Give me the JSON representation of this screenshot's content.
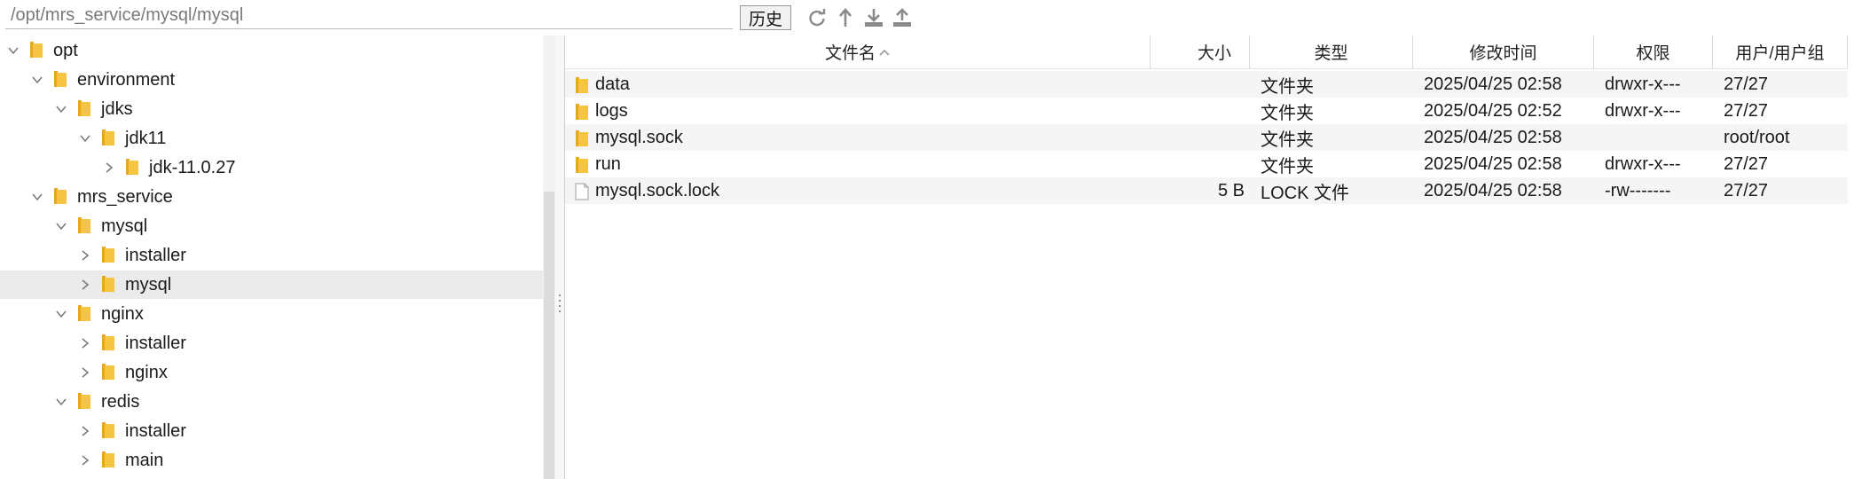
{
  "toolbar": {
    "path_value": "/opt/mrs_service/mysql/mysql",
    "history_label": "历史",
    "icons": [
      "refresh-icon",
      "go-up-icon",
      "download-icon",
      "upload-icon"
    ]
  },
  "tree": {
    "items": [
      {
        "label": "opt",
        "depth": 0,
        "expanded": true
      },
      {
        "label": "environment",
        "depth": 1,
        "expanded": true
      },
      {
        "label": "jdks",
        "depth": 2,
        "expanded": true
      },
      {
        "label": "jdk11",
        "depth": 3,
        "expanded": true
      },
      {
        "label": "jdk-11.0.27",
        "depth": 4,
        "expanded": false
      },
      {
        "label": "mrs_service",
        "depth": 1,
        "expanded": true
      },
      {
        "label": "mysql",
        "depth": 2,
        "expanded": true
      },
      {
        "label": "installer",
        "depth": 3,
        "expanded": false
      },
      {
        "label": "mysql",
        "depth": 3,
        "expanded": false,
        "selected": true
      },
      {
        "label": "nginx",
        "depth": 2,
        "expanded": true
      },
      {
        "label": "installer",
        "depth": 3,
        "expanded": false
      },
      {
        "label": "nginx",
        "depth": 3,
        "expanded": false
      },
      {
        "label": "redis",
        "depth": 2,
        "expanded": true
      },
      {
        "label": "installer",
        "depth": 3,
        "expanded": false
      },
      {
        "label": "main",
        "depth": 3,
        "expanded": false
      }
    ]
  },
  "files": {
    "columns": {
      "name": "文件名",
      "size": "大小",
      "type": "类型",
      "modified": "修改时间",
      "permissions": "权限",
      "owner": "用户/用户组"
    },
    "sort_indicator": "^",
    "rows": [
      {
        "name": "data",
        "size": "",
        "type": "文件夹",
        "modified": "2025/04/25 02:58",
        "permissions": "drwxr-x---",
        "owner": "27/27",
        "icon": "folder-icon"
      },
      {
        "name": "logs",
        "size": "",
        "type": "文件夹",
        "modified": "2025/04/25 02:52",
        "permissions": "drwxr-x---",
        "owner": "27/27",
        "icon": "folder-icon"
      },
      {
        "name": "mysql.sock",
        "size": "",
        "type": "文件夹",
        "modified": "2025/04/25 02:58",
        "permissions": "",
        "owner": "root/root",
        "icon": "folder-icon"
      },
      {
        "name": "run",
        "size": "",
        "type": "文件夹",
        "modified": "2025/04/25 02:58",
        "permissions": "drwxr-x---",
        "owner": "27/27",
        "icon": "folder-icon"
      },
      {
        "name": "mysql.sock.lock",
        "size": "5 B",
        "type": "LOCK 文件",
        "modified": "2025/04/25 02:58",
        "permissions": "-rw-------",
        "owner": "27/27",
        "icon": "file-icon"
      }
    ]
  },
  "colors": {
    "folder": "#f5c542",
    "folder_tab": "#e8a71f",
    "selected_row": "#ebebeb",
    "icon_gray": "#8a8a8a"
  }
}
